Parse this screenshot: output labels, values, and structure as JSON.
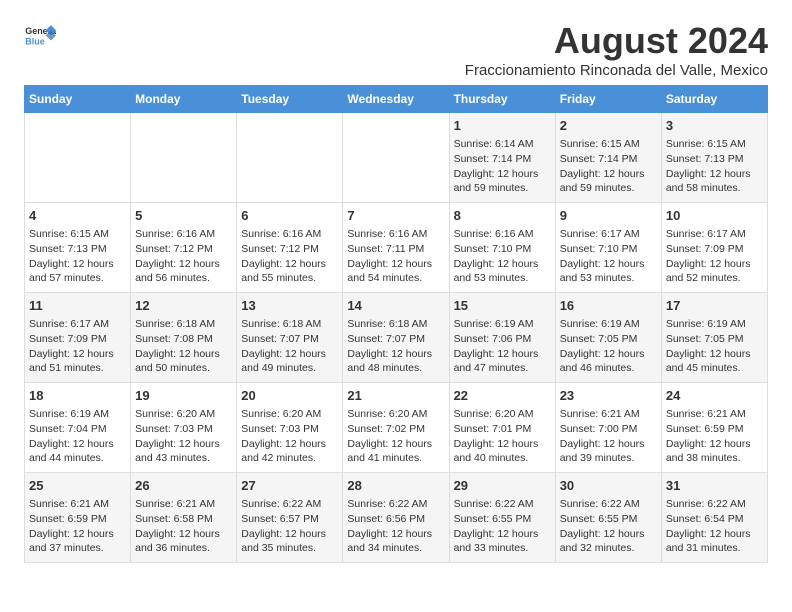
{
  "header": {
    "logo_line1": "General",
    "logo_line2": "Blue",
    "main_title": "August 2024",
    "subtitle": "Fraccionamiento Rinconada del Valle, Mexico"
  },
  "days_of_week": [
    "Sunday",
    "Monday",
    "Tuesday",
    "Wednesday",
    "Thursday",
    "Friday",
    "Saturday"
  ],
  "weeks": [
    [
      {
        "day": "",
        "info": ""
      },
      {
        "day": "",
        "info": ""
      },
      {
        "day": "",
        "info": ""
      },
      {
        "day": "",
        "info": ""
      },
      {
        "day": "1",
        "info": "Sunrise: 6:14 AM\nSunset: 7:14 PM\nDaylight: 12 hours\nand 59 minutes."
      },
      {
        "day": "2",
        "info": "Sunrise: 6:15 AM\nSunset: 7:14 PM\nDaylight: 12 hours\nand 59 minutes."
      },
      {
        "day": "3",
        "info": "Sunrise: 6:15 AM\nSunset: 7:13 PM\nDaylight: 12 hours\nand 58 minutes."
      }
    ],
    [
      {
        "day": "4",
        "info": "Sunrise: 6:15 AM\nSunset: 7:13 PM\nDaylight: 12 hours\nand 57 minutes."
      },
      {
        "day": "5",
        "info": "Sunrise: 6:16 AM\nSunset: 7:12 PM\nDaylight: 12 hours\nand 56 minutes."
      },
      {
        "day": "6",
        "info": "Sunrise: 6:16 AM\nSunset: 7:12 PM\nDaylight: 12 hours\nand 55 minutes."
      },
      {
        "day": "7",
        "info": "Sunrise: 6:16 AM\nSunset: 7:11 PM\nDaylight: 12 hours\nand 54 minutes."
      },
      {
        "day": "8",
        "info": "Sunrise: 6:16 AM\nSunset: 7:10 PM\nDaylight: 12 hours\nand 53 minutes."
      },
      {
        "day": "9",
        "info": "Sunrise: 6:17 AM\nSunset: 7:10 PM\nDaylight: 12 hours\nand 53 minutes."
      },
      {
        "day": "10",
        "info": "Sunrise: 6:17 AM\nSunset: 7:09 PM\nDaylight: 12 hours\nand 52 minutes."
      }
    ],
    [
      {
        "day": "11",
        "info": "Sunrise: 6:17 AM\nSunset: 7:09 PM\nDaylight: 12 hours\nand 51 minutes."
      },
      {
        "day": "12",
        "info": "Sunrise: 6:18 AM\nSunset: 7:08 PM\nDaylight: 12 hours\nand 50 minutes."
      },
      {
        "day": "13",
        "info": "Sunrise: 6:18 AM\nSunset: 7:07 PM\nDaylight: 12 hours\nand 49 minutes."
      },
      {
        "day": "14",
        "info": "Sunrise: 6:18 AM\nSunset: 7:07 PM\nDaylight: 12 hours\nand 48 minutes."
      },
      {
        "day": "15",
        "info": "Sunrise: 6:19 AM\nSunset: 7:06 PM\nDaylight: 12 hours\nand 47 minutes."
      },
      {
        "day": "16",
        "info": "Sunrise: 6:19 AM\nSunset: 7:05 PM\nDaylight: 12 hours\nand 46 minutes."
      },
      {
        "day": "17",
        "info": "Sunrise: 6:19 AM\nSunset: 7:05 PM\nDaylight: 12 hours\nand 45 minutes."
      }
    ],
    [
      {
        "day": "18",
        "info": "Sunrise: 6:19 AM\nSunset: 7:04 PM\nDaylight: 12 hours\nand 44 minutes."
      },
      {
        "day": "19",
        "info": "Sunrise: 6:20 AM\nSunset: 7:03 PM\nDaylight: 12 hours\nand 43 minutes."
      },
      {
        "day": "20",
        "info": "Sunrise: 6:20 AM\nSunset: 7:03 PM\nDaylight: 12 hours\nand 42 minutes."
      },
      {
        "day": "21",
        "info": "Sunrise: 6:20 AM\nSunset: 7:02 PM\nDaylight: 12 hours\nand 41 minutes."
      },
      {
        "day": "22",
        "info": "Sunrise: 6:20 AM\nSunset: 7:01 PM\nDaylight: 12 hours\nand 40 minutes."
      },
      {
        "day": "23",
        "info": "Sunrise: 6:21 AM\nSunset: 7:00 PM\nDaylight: 12 hours\nand 39 minutes."
      },
      {
        "day": "24",
        "info": "Sunrise: 6:21 AM\nSunset: 6:59 PM\nDaylight: 12 hours\nand 38 minutes."
      }
    ],
    [
      {
        "day": "25",
        "info": "Sunrise: 6:21 AM\nSunset: 6:59 PM\nDaylight: 12 hours\nand 37 minutes."
      },
      {
        "day": "26",
        "info": "Sunrise: 6:21 AM\nSunset: 6:58 PM\nDaylight: 12 hours\nand 36 minutes."
      },
      {
        "day": "27",
        "info": "Sunrise: 6:22 AM\nSunset: 6:57 PM\nDaylight: 12 hours\nand 35 minutes."
      },
      {
        "day": "28",
        "info": "Sunrise: 6:22 AM\nSunset: 6:56 PM\nDaylight: 12 hours\nand 34 minutes."
      },
      {
        "day": "29",
        "info": "Sunrise: 6:22 AM\nSunset: 6:55 PM\nDaylight: 12 hours\nand 33 minutes."
      },
      {
        "day": "30",
        "info": "Sunrise: 6:22 AM\nSunset: 6:55 PM\nDaylight: 12 hours\nand 32 minutes."
      },
      {
        "day": "31",
        "info": "Sunrise: 6:22 AM\nSunset: 6:54 PM\nDaylight: 12 hours\nand 31 minutes."
      }
    ]
  ]
}
